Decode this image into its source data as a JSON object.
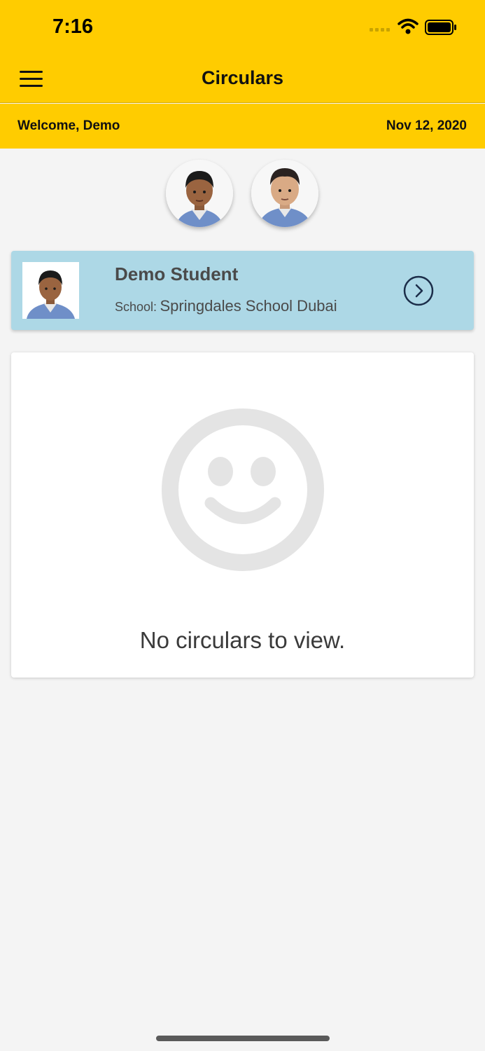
{
  "status_bar": {
    "time": "7:16"
  },
  "header": {
    "title": "Circulars",
    "menu_icon": "hamburger-menu-icon"
  },
  "welcome_bar": {
    "greeting": "Welcome, Demo",
    "date": "Nov 12, 2020"
  },
  "students": [
    {
      "avatar": "student-photo-1"
    },
    {
      "avatar": "student-photo-2"
    }
  ],
  "selected_student": {
    "name": "Demo Student",
    "school_label": "School:",
    "school_name": "Springdales School Dubai",
    "action_icon": "chevron-right-circle-icon"
  },
  "empty_state": {
    "icon": "smiley-face-icon",
    "message": "No circulars to view."
  },
  "colors": {
    "brand": "#ffcc00",
    "card_highlight": "#add8e6",
    "navy": "#1c2e4a",
    "placeholder_gray": "#e4e4e4"
  }
}
